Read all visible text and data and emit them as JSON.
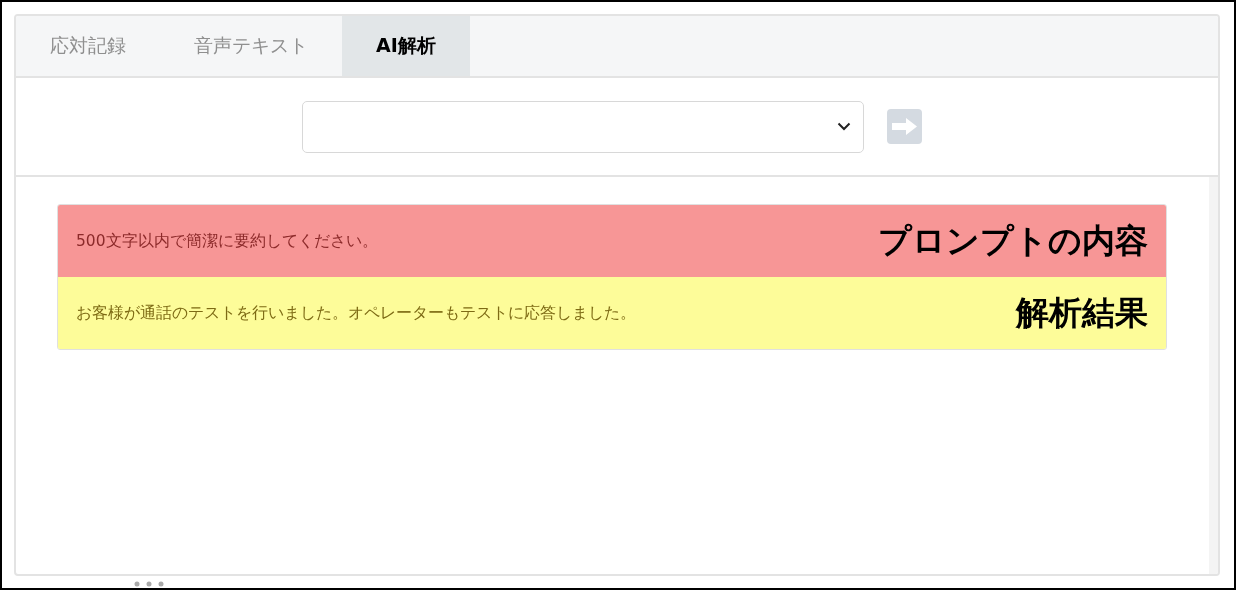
{
  "tabs": [
    {
      "label": "応対記録",
      "selected": false
    },
    {
      "label": "音声テキスト",
      "selected": false
    },
    {
      "label": "AI解析",
      "selected": true
    }
  ],
  "toolbar": {
    "submit_disabled": true
  },
  "results": [
    {
      "kind": "prompt",
      "text": "500文字以内で簡潔に要約してください。",
      "annotation": "プロンプトの内容"
    },
    {
      "kind": "result",
      "text": "お客様が通話のテストを行いました。オペレーターもテストに応答しました。",
      "annotation": "解析結果"
    }
  ]
}
